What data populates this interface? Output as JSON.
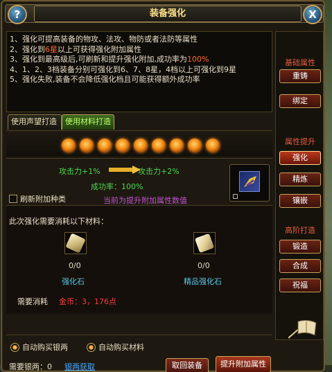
{
  "window": {
    "title": "装备强化"
  },
  "header": {
    "help_icon": "help-icon",
    "help_glyph": "?",
    "close_icon": "close-icon",
    "close_glyph": "X"
  },
  "description": {
    "lines": [
      {
        "text": "1、强化可提高装备的物攻、法攻、物防或者法防等属性"
      },
      {
        "before": "2、强化到",
        "highlight": "6星",
        "after": "以上可获得强化附加属性"
      },
      {
        "before": "3、强化到最高级后,可刷新和提升强化附加,成功率为",
        "highlight": "100%",
        "after": ""
      },
      {
        "text": "4、1、2、3档装备分别可强化到6、7、8星，4档以上可强化到9星"
      },
      {
        "text": "5、强化失败,装备不会降低强化档且可能获得额外成功率"
      }
    ]
  },
  "tabs": [
    {
      "label": "使用声望打造",
      "active": false
    },
    {
      "label": "使用材料打造",
      "active": true
    }
  ],
  "stars": {
    "count": 9,
    "filled": 9,
    "icon": "star-icon"
  },
  "upgrade": {
    "from": "攻击力+1%",
    "to": "攻击力+2%",
    "success_rate": "成功率：100%",
    "refresh_label": "刷新附加种类",
    "refresh_checked": false,
    "note": "当前为提升附加属性数值",
    "item_icon": "equipment-icon"
  },
  "materials": {
    "title": "此次强化需要消耗以下材料：",
    "items": [
      {
        "icon": "strengthen-stone-icon",
        "count": "0/0",
        "name": "强化石"
      },
      {
        "icon": "fine-strengthen-stone-icon",
        "count": "0/0",
        "name": "精品强化石"
      }
    ],
    "cost_label": "需要消耗",
    "cost_value": "金币：3，176点"
  },
  "bottom": {
    "auto_buy_silver": "自动购买银两",
    "auto_buy_material": "自动购买材料",
    "silver_needed": "需要银两：0",
    "silver_link": "银两获取",
    "unequip_button": "取回装备",
    "upgrade_button": "提升附加属性"
  },
  "sidebar": {
    "groups": [
      {
        "header": "基础属性",
        "buttons": [
          "重铸",
          "绑定"
        ]
      },
      {
        "header": "属性提升",
        "buttons": [
          "强化",
          "精炼",
          "镶嵌"
        ]
      },
      {
        "header": "高阶打造",
        "buttons": [
          "锻造",
          "合成",
          "祝福"
        ]
      }
    ],
    "active": "强化"
  },
  "colors": {
    "title": "#ffe08a",
    "stat_green": "#4cd64c",
    "highlight_orange": "#ff6a2a",
    "note_purple": "#c052d0",
    "material_cyan": "#58c8e8",
    "cost_red": "#ff3c3c",
    "sidebar_header": "#e65a3a"
  }
}
